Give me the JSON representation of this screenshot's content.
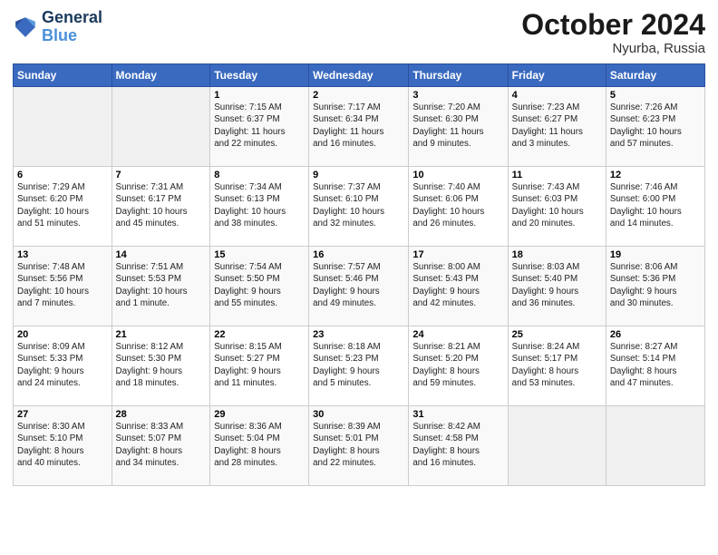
{
  "header": {
    "logo_line1": "General",
    "logo_line2": "Blue",
    "month_title": "October 2024",
    "location": "Nyurba, Russia"
  },
  "weekdays": [
    "Sunday",
    "Monday",
    "Tuesday",
    "Wednesday",
    "Thursday",
    "Friday",
    "Saturday"
  ],
  "weeks": [
    [
      {
        "day": "",
        "info": ""
      },
      {
        "day": "",
        "info": ""
      },
      {
        "day": "1",
        "info": "Sunrise: 7:15 AM\nSunset: 6:37 PM\nDaylight: 11 hours\nand 22 minutes."
      },
      {
        "day": "2",
        "info": "Sunrise: 7:17 AM\nSunset: 6:34 PM\nDaylight: 11 hours\nand 16 minutes."
      },
      {
        "day": "3",
        "info": "Sunrise: 7:20 AM\nSunset: 6:30 PM\nDaylight: 11 hours\nand 9 minutes."
      },
      {
        "day": "4",
        "info": "Sunrise: 7:23 AM\nSunset: 6:27 PM\nDaylight: 11 hours\nand 3 minutes."
      },
      {
        "day": "5",
        "info": "Sunrise: 7:26 AM\nSunset: 6:23 PM\nDaylight: 10 hours\nand 57 minutes."
      }
    ],
    [
      {
        "day": "6",
        "info": "Sunrise: 7:29 AM\nSunset: 6:20 PM\nDaylight: 10 hours\nand 51 minutes."
      },
      {
        "day": "7",
        "info": "Sunrise: 7:31 AM\nSunset: 6:17 PM\nDaylight: 10 hours\nand 45 minutes."
      },
      {
        "day": "8",
        "info": "Sunrise: 7:34 AM\nSunset: 6:13 PM\nDaylight: 10 hours\nand 38 minutes."
      },
      {
        "day": "9",
        "info": "Sunrise: 7:37 AM\nSunset: 6:10 PM\nDaylight: 10 hours\nand 32 minutes."
      },
      {
        "day": "10",
        "info": "Sunrise: 7:40 AM\nSunset: 6:06 PM\nDaylight: 10 hours\nand 26 minutes."
      },
      {
        "day": "11",
        "info": "Sunrise: 7:43 AM\nSunset: 6:03 PM\nDaylight: 10 hours\nand 20 minutes."
      },
      {
        "day": "12",
        "info": "Sunrise: 7:46 AM\nSunset: 6:00 PM\nDaylight: 10 hours\nand 14 minutes."
      }
    ],
    [
      {
        "day": "13",
        "info": "Sunrise: 7:48 AM\nSunset: 5:56 PM\nDaylight: 10 hours\nand 7 minutes."
      },
      {
        "day": "14",
        "info": "Sunrise: 7:51 AM\nSunset: 5:53 PM\nDaylight: 10 hours\nand 1 minute."
      },
      {
        "day": "15",
        "info": "Sunrise: 7:54 AM\nSunset: 5:50 PM\nDaylight: 9 hours\nand 55 minutes."
      },
      {
        "day": "16",
        "info": "Sunrise: 7:57 AM\nSunset: 5:46 PM\nDaylight: 9 hours\nand 49 minutes."
      },
      {
        "day": "17",
        "info": "Sunrise: 8:00 AM\nSunset: 5:43 PM\nDaylight: 9 hours\nand 42 minutes."
      },
      {
        "day": "18",
        "info": "Sunrise: 8:03 AM\nSunset: 5:40 PM\nDaylight: 9 hours\nand 36 minutes."
      },
      {
        "day": "19",
        "info": "Sunrise: 8:06 AM\nSunset: 5:36 PM\nDaylight: 9 hours\nand 30 minutes."
      }
    ],
    [
      {
        "day": "20",
        "info": "Sunrise: 8:09 AM\nSunset: 5:33 PM\nDaylight: 9 hours\nand 24 minutes."
      },
      {
        "day": "21",
        "info": "Sunrise: 8:12 AM\nSunset: 5:30 PM\nDaylight: 9 hours\nand 18 minutes."
      },
      {
        "day": "22",
        "info": "Sunrise: 8:15 AM\nSunset: 5:27 PM\nDaylight: 9 hours\nand 11 minutes."
      },
      {
        "day": "23",
        "info": "Sunrise: 8:18 AM\nSunset: 5:23 PM\nDaylight: 9 hours\nand 5 minutes."
      },
      {
        "day": "24",
        "info": "Sunrise: 8:21 AM\nSunset: 5:20 PM\nDaylight: 8 hours\nand 59 minutes."
      },
      {
        "day": "25",
        "info": "Sunrise: 8:24 AM\nSunset: 5:17 PM\nDaylight: 8 hours\nand 53 minutes."
      },
      {
        "day": "26",
        "info": "Sunrise: 8:27 AM\nSunset: 5:14 PM\nDaylight: 8 hours\nand 47 minutes."
      }
    ],
    [
      {
        "day": "27",
        "info": "Sunrise: 8:30 AM\nSunset: 5:10 PM\nDaylight: 8 hours\nand 40 minutes."
      },
      {
        "day": "28",
        "info": "Sunrise: 8:33 AM\nSunset: 5:07 PM\nDaylight: 8 hours\nand 34 minutes."
      },
      {
        "day": "29",
        "info": "Sunrise: 8:36 AM\nSunset: 5:04 PM\nDaylight: 8 hours\nand 28 minutes."
      },
      {
        "day": "30",
        "info": "Sunrise: 8:39 AM\nSunset: 5:01 PM\nDaylight: 8 hours\nand 22 minutes."
      },
      {
        "day": "31",
        "info": "Sunrise: 8:42 AM\nSunset: 4:58 PM\nDaylight: 8 hours\nand 16 minutes."
      },
      {
        "day": "",
        "info": ""
      },
      {
        "day": "",
        "info": ""
      }
    ]
  ]
}
